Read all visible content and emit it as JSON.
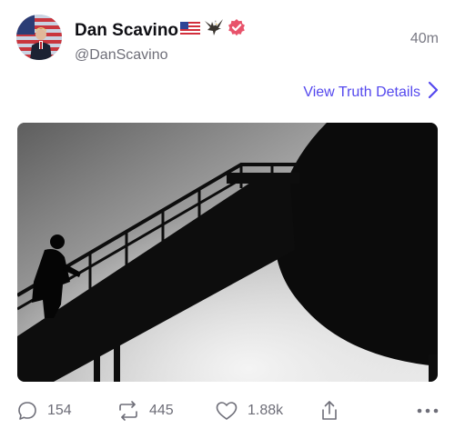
{
  "header": {
    "display_name": "Dan Scavino",
    "handle": "@DanScavino",
    "time": "40m",
    "verified": true,
    "icons": [
      "us-flag-icon",
      "eagle-icon",
      "verified-badge-icon"
    ],
    "verified_color": "#e8536b"
  },
  "details_link": {
    "label": "View Truth Details",
    "color": "#5448ee"
  },
  "post": {
    "media": "image"
  },
  "actions": {
    "replies": "154",
    "retruths": "445",
    "likes": "1.88k"
  }
}
